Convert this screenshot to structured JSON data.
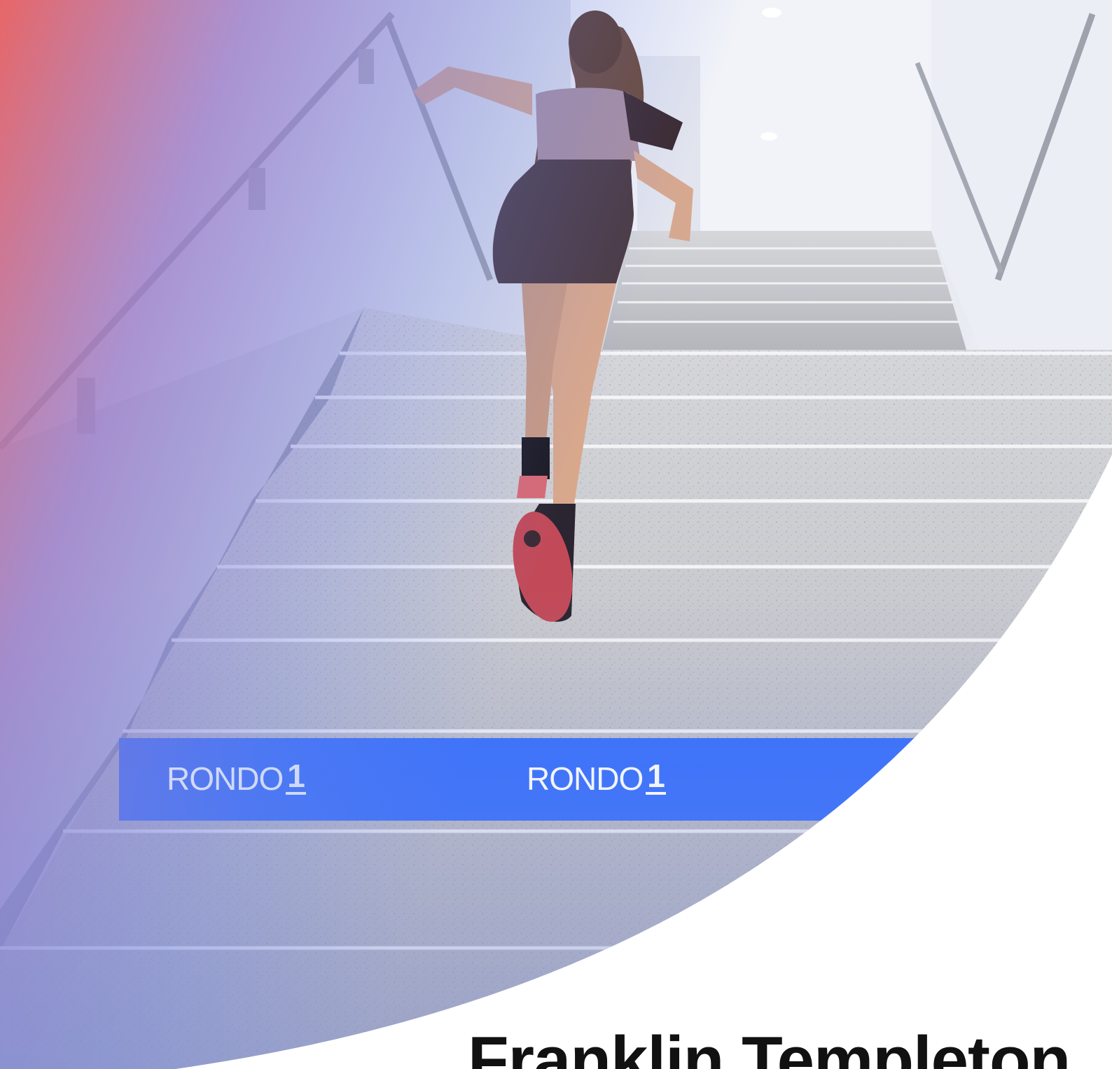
{
  "banner": {
    "color": "#3570ff",
    "logos": [
      {
        "text": "RONDO",
        "mark": "1"
      },
      {
        "text": "RONDO",
        "mark": "1"
      }
    ]
  },
  "overlay_gradient": [
    "#e86060",
    "#9a78c8",
    "#6a80e8"
  ],
  "footer": {
    "title": "Franklin Templeton"
  }
}
